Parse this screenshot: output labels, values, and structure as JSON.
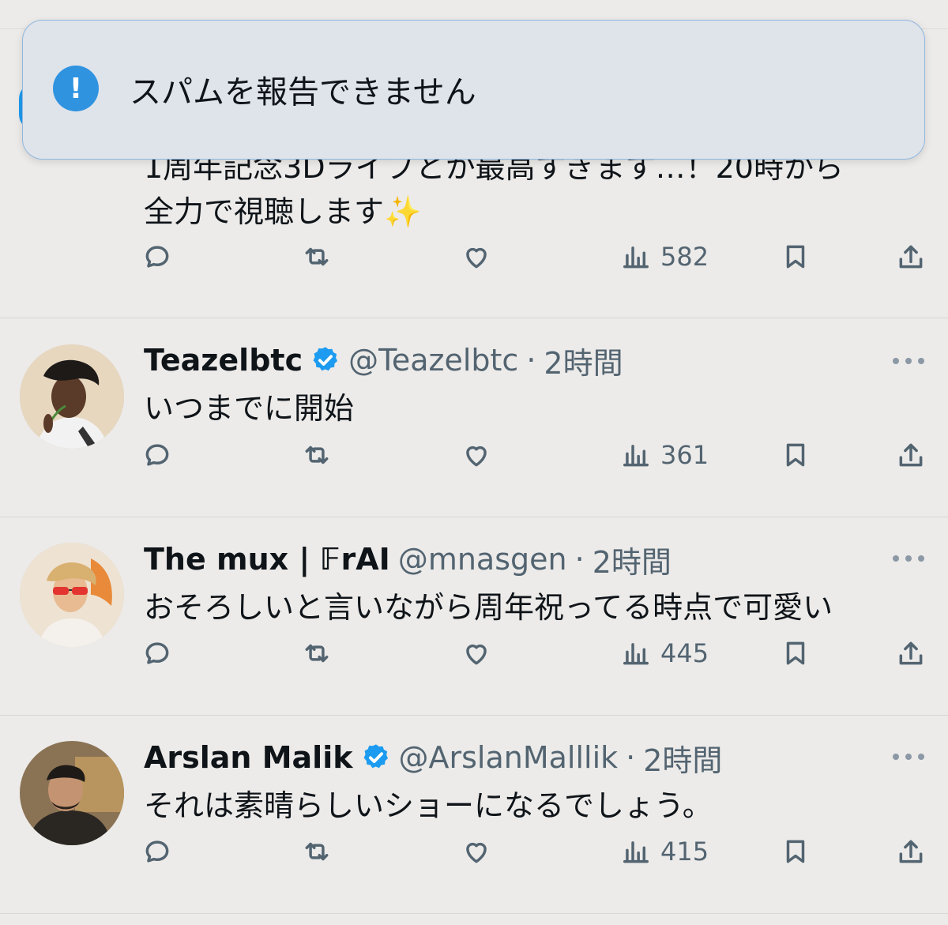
{
  "toast": {
    "message": "スパムを報告できません"
  },
  "tweets": [
    {
      "lines": [
        "1周年記念3Dライブとか最高すぎます…！20時から",
        "全力で視聴します✨"
      ],
      "views": "582"
    },
    {
      "name": "Teazelbtc",
      "verified": true,
      "handle": "@Teazelbtc",
      "time": "2時間",
      "text": "いつまでに開始",
      "views": "361"
    },
    {
      "name": "The mux | 𝔽rAI",
      "verified": false,
      "handle": "@mnasgen",
      "time": "2時間",
      "text": "おそろしいと言いながら周年祝ってる時点で可愛い",
      "views": "445"
    },
    {
      "name": "Arslan Malik",
      "verified": true,
      "handle": "@ArslanMalllik",
      "time": "2時間",
      "text": "それは素晴らしいショーになるでしょう。",
      "views": "415"
    }
  ],
  "colors": {
    "verified": "#1d9bf0",
    "toast_icon": "#2f93e0",
    "secondary_text": "#536471"
  },
  "icons": [
    "reply-icon",
    "retweet-icon",
    "like-icon",
    "views-icon",
    "bookmark-icon",
    "share-icon",
    "more-icon",
    "verified-icon",
    "alert-icon"
  ]
}
